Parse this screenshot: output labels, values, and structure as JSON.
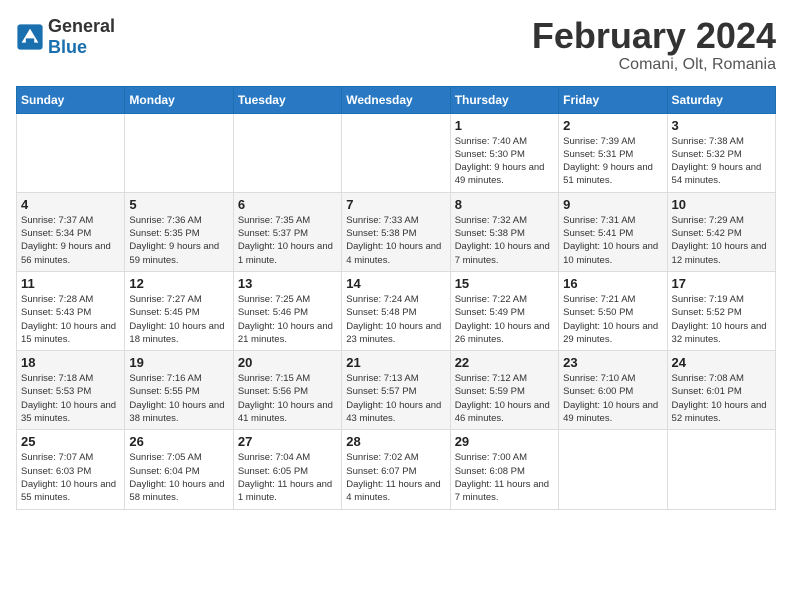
{
  "logo": {
    "general": "General",
    "blue": "Blue"
  },
  "header": {
    "title": "February 2024",
    "subtitle": "Comani, Olt, Romania"
  },
  "weekdays": [
    "Sunday",
    "Monday",
    "Tuesday",
    "Wednesday",
    "Thursday",
    "Friday",
    "Saturday"
  ],
  "weeks": [
    [
      {
        "day": "",
        "info": ""
      },
      {
        "day": "",
        "info": ""
      },
      {
        "day": "",
        "info": ""
      },
      {
        "day": "",
        "info": ""
      },
      {
        "day": "1",
        "info": "Sunrise: 7:40 AM\nSunset: 5:30 PM\nDaylight: 9 hours\nand 49 minutes."
      },
      {
        "day": "2",
        "info": "Sunrise: 7:39 AM\nSunset: 5:31 PM\nDaylight: 9 hours\nand 51 minutes."
      },
      {
        "day": "3",
        "info": "Sunrise: 7:38 AM\nSunset: 5:32 PM\nDaylight: 9 hours\nand 54 minutes."
      }
    ],
    [
      {
        "day": "4",
        "info": "Sunrise: 7:37 AM\nSunset: 5:34 PM\nDaylight: 9 hours\nand 56 minutes."
      },
      {
        "day": "5",
        "info": "Sunrise: 7:36 AM\nSunset: 5:35 PM\nDaylight: 9 hours\nand 59 minutes."
      },
      {
        "day": "6",
        "info": "Sunrise: 7:35 AM\nSunset: 5:37 PM\nDaylight: 10 hours\nand 1 minute."
      },
      {
        "day": "7",
        "info": "Sunrise: 7:33 AM\nSunset: 5:38 PM\nDaylight: 10 hours\nand 4 minutes."
      },
      {
        "day": "8",
        "info": "Sunrise: 7:32 AM\nSunset: 5:38 PM\nDaylight: 10 hours\nand 7 minutes."
      },
      {
        "day": "9",
        "info": "Sunrise: 7:31 AM\nSunset: 5:41 PM\nDaylight: 10 hours\nand 10 minutes."
      },
      {
        "day": "10",
        "info": "Sunrise: 7:29 AM\nSunset: 5:42 PM\nDaylight: 10 hours\nand 12 minutes."
      }
    ],
    [
      {
        "day": "11",
        "info": "Sunrise: 7:28 AM\nSunset: 5:43 PM\nDaylight: 10 hours\nand 15 minutes."
      },
      {
        "day": "12",
        "info": "Sunrise: 7:27 AM\nSunset: 5:45 PM\nDaylight: 10 hours\nand 18 minutes."
      },
      {
        "day": "13",
        "info": "Sunrise: 7:25 AM\nSunset: 5:46 PM\nDaylight: 10 hours\nand 21 minutes."
      },
      {
        "day": "14",
        "info": "Sunrise: 7:24 AM\nSunset: 5:48 PM\nDaylight: 10 hours\nand 23 minutes."
      },
      {
        "day": "15",
        "info": "Sunrise: 7:22 AM\nSunset: 5:49 PM\nDaylight: 10 hours\nand 26 minutes."
      },
      {
        "day": "16",
        "info": "Sunrise: 7:21 AM\nSunset: 5:50 PM\nDaylight: 10 hours\nand 29 minutes."
      },
      {
        "day": "17",
        "info": "Sunrise: 7:19 AM\nSunset: 5:52 PM\nDaylight: 10 hours\nand 32 minutes."
      }
    ],
    [
      {
        "day": "18",
        "info": "Sunrise: 7:18 AM\nSunset: 5:53 PM\nDaylight: 10 hours\nand 35 minutes."
      },
      {
        "day": "19",
        "info": "Sunrise: 7:16 AM\nSunset: 5:55 PM\nDaylight: 10 hours\nand 38 minutes."
      },
      {
        "day": "20",
        "info": "Sunrise: 7:15 AM\nSunset: 5:56 PM\nDaylight: 10 hours\nand 41 minutes."
      },
      {
        "day": "21",
        "info": "Sunrise: 7:13 AM\nSunset: 5:57 PM\nDaylight: 10 hours\nand 43 minutes."
      },
      {
        "day": "22",
        "info": "Sunrise: 7:12 AM\nSunset: 5:59 PM\nDaylight: 10 hours\nand 46 minutes."
      },
      {
        "day": "23",
        "info": "Sunrise: 7:10 AM\nSunset: 6:00 PM\nDaylight: 10 hours\nand 49 minutes."
      },
      {
        "day": "24",
        "info": "Sunrise: 7:08 AM\nSunset: 6:01 PM\nDaylight: 10 hours\nand 52 minutes."
      }
    ],
    [
      {
        "day": "25",
        "info": "Sunrise: 7:07 AM\nSunset: 6:03 PM\nDaylight: 10 hours\nand 55 minutes."
      },
      {
        "day": "26",
        "info": "Sunrise: 7:05 AM\nSunset: 6:04 PM\nDaylight: 10 hours\nand 58 minutes."
      },
      {
        "day": "27",
        "info": "Sunrise: 7:04 AM\nSunset: 6:05 PM\nDaylight: 11 hours\nand 1 minute."
      },
      {
        "day": "28",
        "info": "Sunrise: 7:02 AM\nSunset: 6:07 PM\nDaylight: 11 hours\nand 4 minutes."
      },
      {
        "day": "29",
        "info": "Sunrise: 7:00 AM\nSunset: 6:08 PM\nDaylight: 11 hours\nand 7 minutes."
      },
      {
        "day": "",
        "info": ""
      },
      {
        "day": "",
        "info": ""
      }
    ]
  ]
}
